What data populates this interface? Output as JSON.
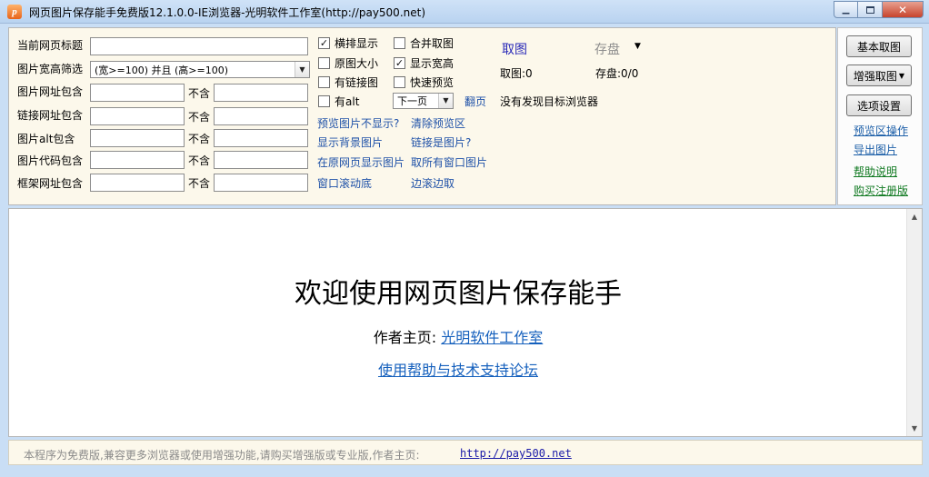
{
  "window": {
    "title": "网页图片保存能手免费版12.1.0.0-IE浏览器-光明软件工作室(http://pay500.net)",
    "icon_label": "p"
  },
  "filters": {
    "page_title_label": "当前网页标题",
    "size_filter_label": "图片宽高筛选",
    "size_filter_value": "(宽>=100) 并且 (高>=100)",
    "img_url_label": "图片网址包含",
    "link_url_label": "链接网址包含",
    "alt_label": "图片alt包含",
    "code_label": "图片代码包含",
    "frame_label": "框架网址包含",
    "exclude_label": "不含"
  },
  "options": {
    "horizontal": "横排显示",
    "merge": "合并取图",
    "original_size": "原图大小",
    "show_wh": "显示宽高",
    "has_link": "有链接图",
    "quick_preview": "快速预览",
    "has_alt": "有alt",
    "page_select": "下一页",
    "flip": "翻页"
  },
  "links": {
    "preview_not_shown": "预览图片不显示?",
    "clear_preview": "清除预览区",
    "show_bg": "显示背景图片",
    "link_is_image": "链接是图片?",
    "show_in_page": "在原网页显示图片",
    "grab_all_windows": "取所有窗口图片",
    "scroll_bottom": "窗口滚动底",
    "scroll_grab": "边滚边取"
  },
  "grab": {
    "grab_label": "取图",
    "save_label": "存盘",
    "grab_count": "取图:0",
    "save_count": "存盘:0/0",
    "browser_status": "没有发现目标浏览器"
  },
  "side": {
    "basic_grab": "基本取图",
    "enhanced_grab": "增强取图",
    "settings": "选项设置",
    "preview_ops": "预览区操作",
    "export_images": "导出图片",
    "help": "帮助说明",
    "buy": "购买注册版"
  },
  "browser": {
    "welcome": "欢迎使用网页图片保存能手",
    "author_prefix": "作者主页:",
    "author_link": "光明软件工作室",
    "forum_link": "使用帮助与技术支持论坛"
  },
  "status": {
    "text": "本程序为免费版,兼容更多浏览器或使用增强功能,请购买增强版或专业版,作者主页:",
    "link": "http://pay500.net"
  }
}
